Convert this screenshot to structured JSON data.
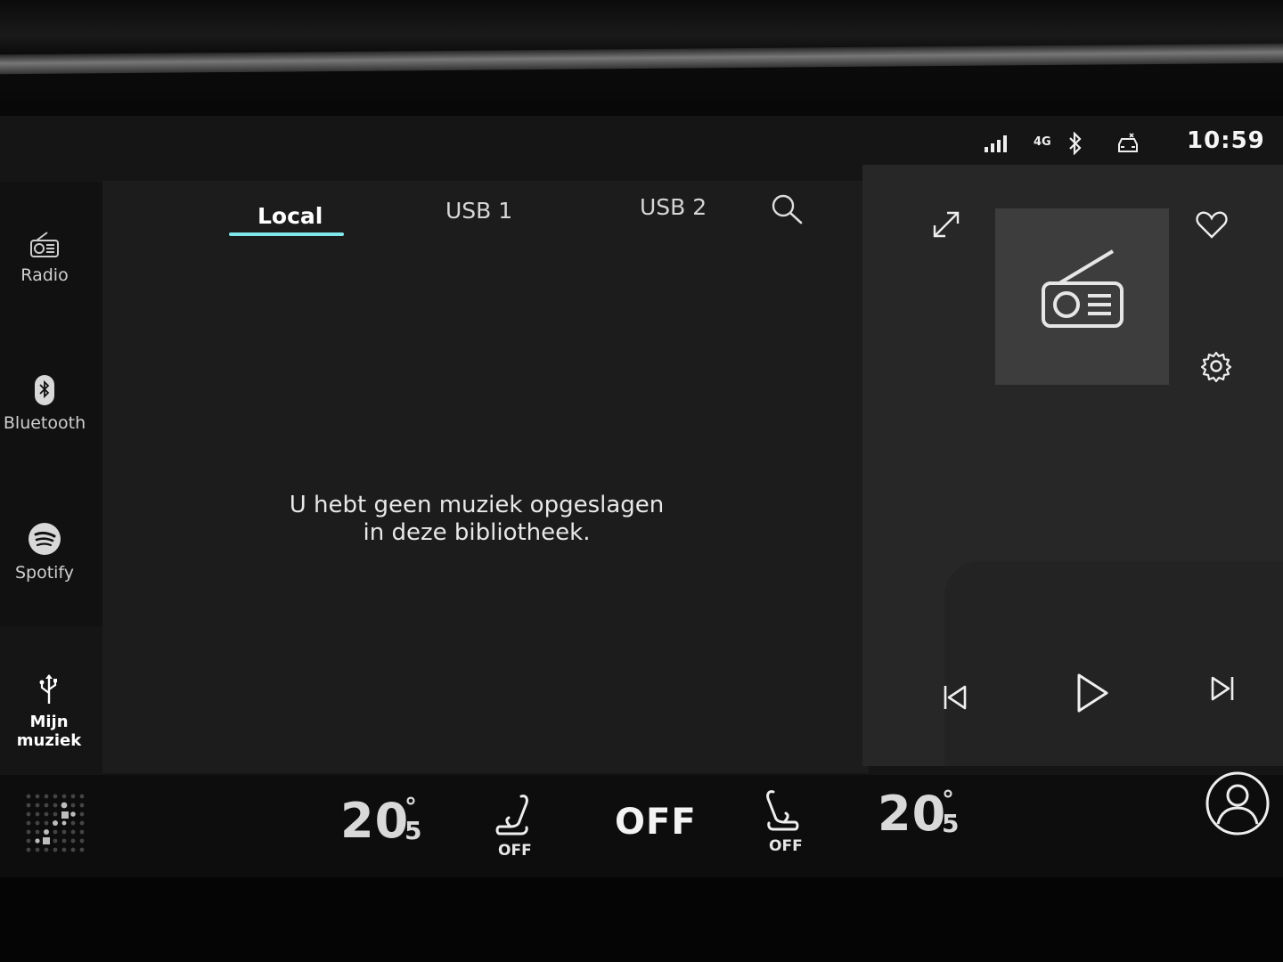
{
  "status": {
    "network_label": "4G",
    "time": "10:59"
  },
  "sidebar": {
    "items": [
      {
        "label": "Radio",
        "icon": "radio-icon"
      },
      {
        "label": "Bluetooth",
        "icon": "bluetooth-icon"
      },
      {
        "label": "Spotify",
        "icon": "spotify-icon"
      },
      {
        "label": "Mijn muziek",
        "icon": "usb-icon"
      }
    ]
  },
  "tabs": [
    {
      "label": "Local",
      "active": true
    },
    {
      "label": "USB 1",
      "active": false
    },
    {
      "label": "USB 2",
      "active": false
    }
  ],
  "main": {
    "empty_line1": "U hebt geen muziek opgeslagen",
    "empty_line2": "in deze bibliotheek."
  },
  "climate": {
    "left_temp_main": "20",
    "left_temp_deg": "°",
    "left_temp_decimal": "5",
    "left_seat_label": "OFF",
    "fan_status": "OFF",
    "right_seat_label": "OFF",
    "right_temp_main": "20",
    "right_temp_deg": "°",
    "right_temp_decimal": "5"
  },
  "colors": {
    "accent": "#7fe7ea",
    "panel_main": "#1c1c1c",
    "panel_right": "#272727"
  }
}
